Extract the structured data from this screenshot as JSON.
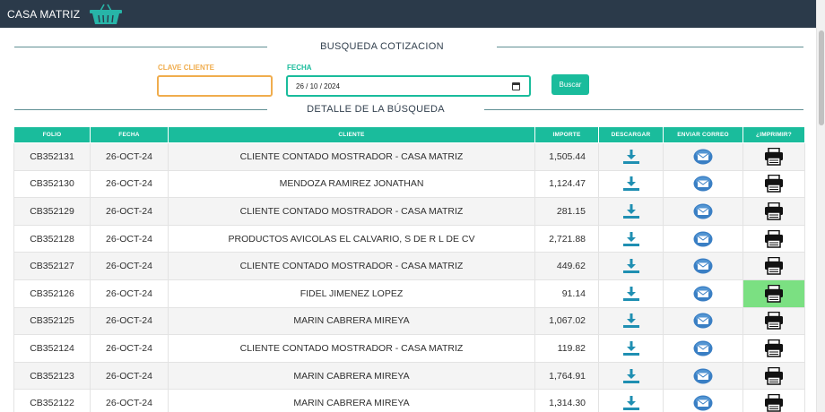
{
  "app": {
    "title": "CASA MATRIZ",
    "logo_icon": "shopping-basket-icon"
  },
  "search": {
    "title": "BUSQUEDA COTIZACION",
    "clave_label": "CLAVE CLIENTE",
    "clave_value": "",
    "fecha_label": "FECHA",
    "fecha_value": "26 / 10 / 2024",
    "button_label": "Buscar"
  },
  "results": {
    "title": "DETALLE DE LA BÚSQUEDA",
    "columns": [
      "FOLIO",
      "FECHA",
      "CLIENTE",
      "IMPORTE",
      "DESCARGAR",
      "ENVIAR CORREO",
      "¿IMPRIMIR?"
    ],
    "rows": [
      {
        "folio": "CB352131",
        "fecha": "26-OCT-24",
        "cliente": "CLIENTE CONTADO MOSTRADOR - CASA MATRIZ",
        "importe": "1,505.44"
      },
      {
        "folio": "CB352130",
        "fecha": "26-OCT-24",
        "cliente": "MENDOZA RAMIREZ JONATHAN",
        "importe": "1,124.47"
      },
      {
        "folio": "CB352129",
        "fecha": "26-OCT-24",
        "cliente": "CLIENTE CONTADO MOSTRADOR - CASA MATRIZ",
        "importe": "281.15"
      },
      {
        "folio": "CB352128",
        "fecha": "26-OCT-24",
        "cliente": "PRODUCTOS AVICOLAS EL CALVARIO, S DE R L DE CV",
        "importe": "2,721.88"
      },
      {
        "folio": "CB352127",
        "fecha": "26-OCT-24",
        "cliente": "CLIENTE CONTADO MOSTRADOR - CASA MATRIZ",
        "importe": "449.62"
      },
      {
        "folio": "CB352126",
        "fecha": "26-OCT-24",
        "cliente": "FIDEL JIMENEZ LOPEZ",
        "importe": "91.14"
      },
      {
        "folio": "CB352125",
        "fecha": "26-OCT-24",
        "cliente": "MARIN CABRERA MIREYA",
        "importe": "1,067.02"
      },
      {
        "folio": "CB352124",
        "fecha": "26-OCT-24",
        "cliente": "CLIENTE CONTADO MOSTRADOR - CASA MATRIZ",
        "importe": "119.82"
      },
      {
        "folio": "CB352123",
        "fecha": "26-OCT-24",
        "cliente": "MARIN CABRERA MIREYA",
        "importe": "1,764.91"
      },
      {
        "folio": "CB352122",
        "fecha": "26-OCT-24",
        "cliente": "MARIN CABRERA MIREYA",
        "importe": "1,314.30"
      }
    ],
    "hovered_print_row": 5,
    "icons": {
      "download": "download-icon",
      "email": "email-icon",
      "print": "printer-icon"
    }
  },
  "colors": {
    "navbar": "#2b3a4a",
    "accent": "#1abc9c",
    "clave_border": "#f0ad4e",
    "hover": "#7be082"
  }
}
